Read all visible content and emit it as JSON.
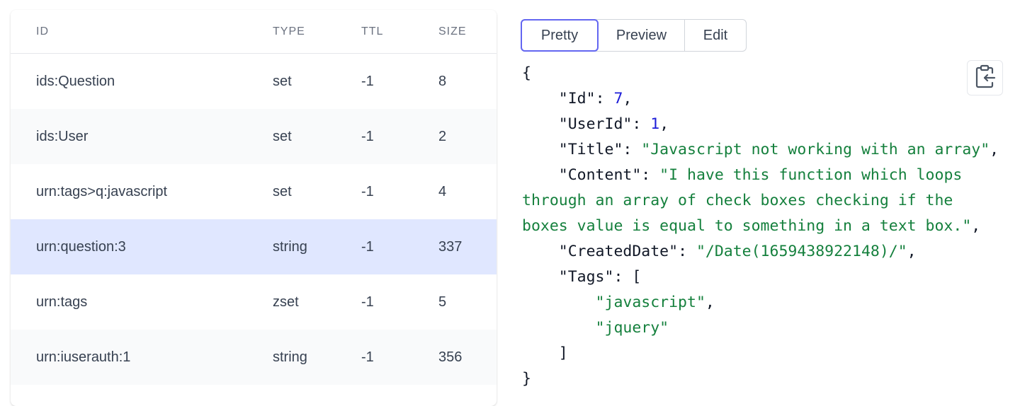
{
  "table": {
    "headers": {
      "id": "ID",
      "type": "TYPE",
      "ttl": "TTL",
      "size": "SIZE"
    },
    "rows": [
      {
        "id": "ids:Question",
        "type": "set",
        "ttl": "-1",
        "size": "8"
      },
      {
        "id": "ids:User",
        "type": "set",
        "ttl": "-1",
        "size": "2"
      },
      {
        "id": "urn:tags>q:javascript",
        "type": "set",
        "ttl": "-1",
        "size": "4"
      },
      {
        "id": "urn:question:3",
        "type": "string",
        "ttl": "-1",
        "size": "337",
        "selected": true
      },
      {
        "id": "urn:tags",
        "type": "zset",
        "ttl": "-1",
        "size": "5"
      },
      {
        "id": "urn:iuserauth:1",
        "type": "string",
        "ttl": "-1",
        "size": "356"
      }
    ]
  },
  "tabs": [
    {
      "label": "Pretty",
      "active": true
    },
    {
      "label": "Preview",
      "active": false
    },
    {
      "label": "Edit",
      "active": false
    }
  ],
  "json_view": {
    "open_brace": "{",
    "id_key": "\"Id\"",
    "id_val": "7",
    "userid_key": "\"UserId\"",
    "userid_val": "1",
    "title_key": "\"Title\"",
    "title_val": "\"Javascript not working with an array\"",
    "content_key": "\"Content\"",
    "content_val_line1": "\"I have this function which loops",
    "content_val_line2": "through an array of check boxes checking if the",
    "content_val_line3": "boxes value is equal to something in a text box.\"",
    "createddate_key": "\"CreatedDate\"",
    "createddate_val": "\"/Date(1659438922148)/\"",
    "tags_key": "\"Tags\"",
    "tags_open": "[",
    "tag1": "\"javascript\"",
    "tag2": "\"jquery\"",
    "tags_close": "]",
    "close_brace": "}"
  },
  "icons": {
    "copy": "clipboard-copy-icon"
  },
  "colors": {
    "selected_row": "#e0e7ff",
    "active_tab_border": "#6366f1",
    "number": "#1d1dd8",
    "string": "#15803d"
  }
}
